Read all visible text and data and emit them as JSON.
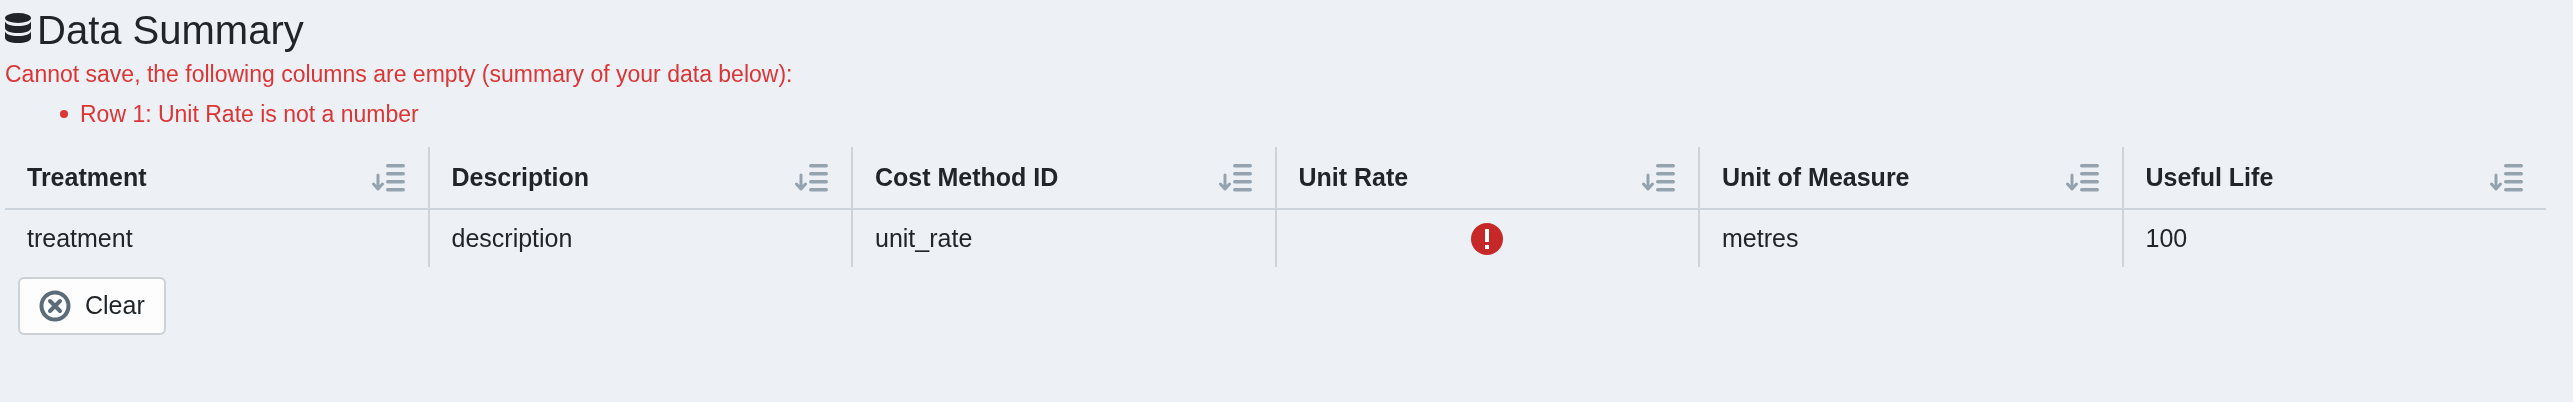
{
  "title": "Data Summary",
  "error_message": "Cannot save, the following columns are empty (summary of your data below):",
  "errors": [
    "Row 1: Unit Rate is not a number"
  ],
  "table": {
    "columns": [
      "Treatment",
      "Description",
      "Cost Method ID",
      "Unit Rate",
      "Unit of Measure",
      "Useful Life"
    ],
    "rows": [
      {
        "cells": [
          {
            "kind": "text",
            "text": "treatment"
          },
          {
            "kind": "text",
            "text": "description"
          },
          {
            "kind": "text",
            "text": "unit_rate"
          },
          {
            "kind": "error"
          },
          {
            "kind": "text",
            "text": "metres"
          },
          {
            "kind": "text",
            "text": "100"
          }
        ]
      }
    ]
  },
  "buttons": [
    {
      "label": "Clear"
    }
  ]
}
